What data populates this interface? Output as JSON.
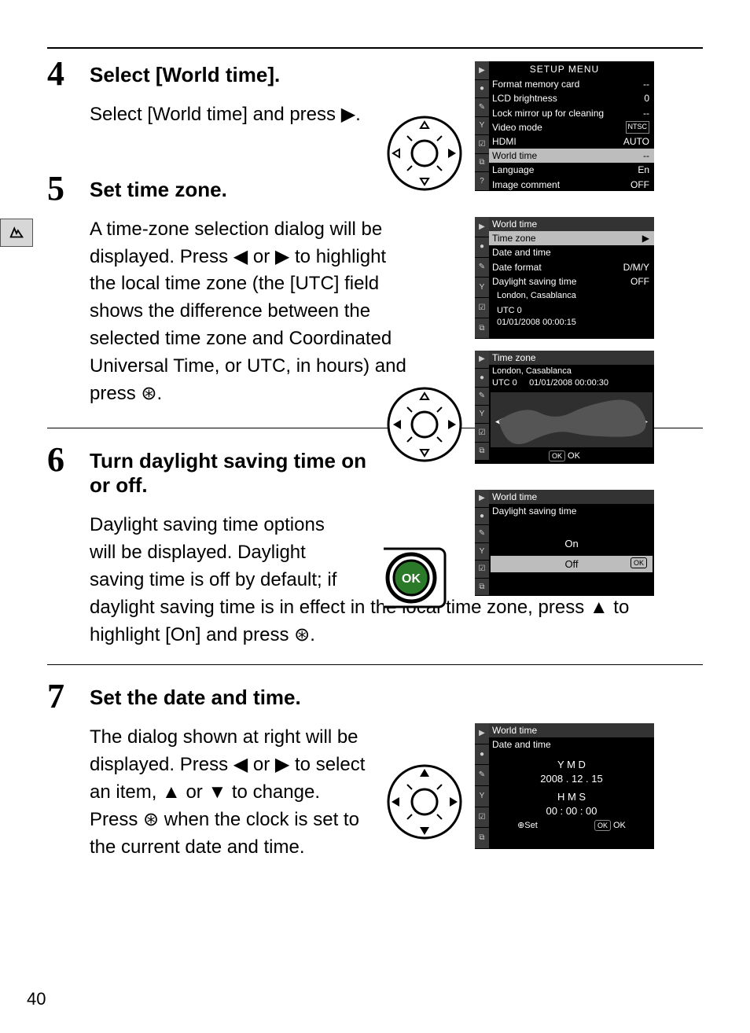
{
  "page_number": "40",
  "step4": {
    "num": "4",
    "title": "Select [World time].",
    "para": "Select [World time] and press ▶."
  },
  "step5": {
    "num": "5",
    "title": "Set time zone.",
    "para": "A time-zone selection dialog will be displayed.  Press ◀ or ▶ to highlight the local time zone (the [UTC] field shows the difference between the selected time zone and Coordinated Universal Time, or UTC, in hours) and press ⊛."
  },
  "step6": {
    "num": "6",
    "title": "Turn daylight saving time on or off.",
    "para1": "Daylight saving time options will be displayed.  Daylight saving time is off by default; if",
    "para2": "daylight saving time is in effect in the local time zone, press ▲ to highlight [On] and press ⊛."
  },
  "step7": {
    "num": "7",
    "title": "Set the date and time.",
    "para": "The dialog shown at right will be displayed.  Press ◀ or ▶ to select an item, ▲ or ▼ to change.  Press ⊛ when the clock is set to the current date and time."
  },
  "setup_menu": {
    "title": "SETUP MENU",
    "items": [
      {
        "label": "Format memory card",
        "value": "--"
      },
      {
        "label": "LCD brightness",
        "value": "0"
      },
      {
        "label": "Lock mirror up for cleaning",
        "value": "--"
      },
      {
        "label": "Video mode",
        "value": "NTSC"
      },
      {
        "label": "HDMI",
        "value": "AUTO"
      },
      {
        "label": "World time",
        "value": "--",
        "hi": true
      },
      {
        "label": "Language",
        "value": "En"
      },
      {
        "label": "Image comment",
        "value": "OFF"
      }
    ]
  },
  "world_time_menu": {
    "title": "World time",
    "rows": [
      {
        "label": "Time zone",
        "value": "▶",
        "hi": true
      },
      {
        "label": "Date and time",
        "value": ""
      },
      {
        "label": "Date format",
        "value": "D/M/Y"
      },
      {
        "label": "Daylight saving time",
        "value": "OFF"
      }
    ],
    "loc": "London, Casablanca",
    "utc": "UTC 0",
    "ts": "01/01/2008 00:00:15"
  },
  "tz_screen": {
    "title": "Time zone",
    "loc": "London, Casablanca",
    "utc": "UTC  0",
    "ts": "01/01/2008 00:00:30",
    "foot": "OK"
  },
  "dst_screen": {
    "title": "World time",
    "sub": "Daylight saving time",
    "on": "On",
    "off": "Off"
  },
  "dt_screen": {
    "title": "World time",
    "sub": "Date and time",
    "ymd_labels": "Y   M   D",
    "ymd": "2008 . 12 . 15",
    "hms_labels": "H   M   S",
    "hms": "00 : 00 : 00",
    "set": "⊕Set",
    "ok": "OK"
  }
}
